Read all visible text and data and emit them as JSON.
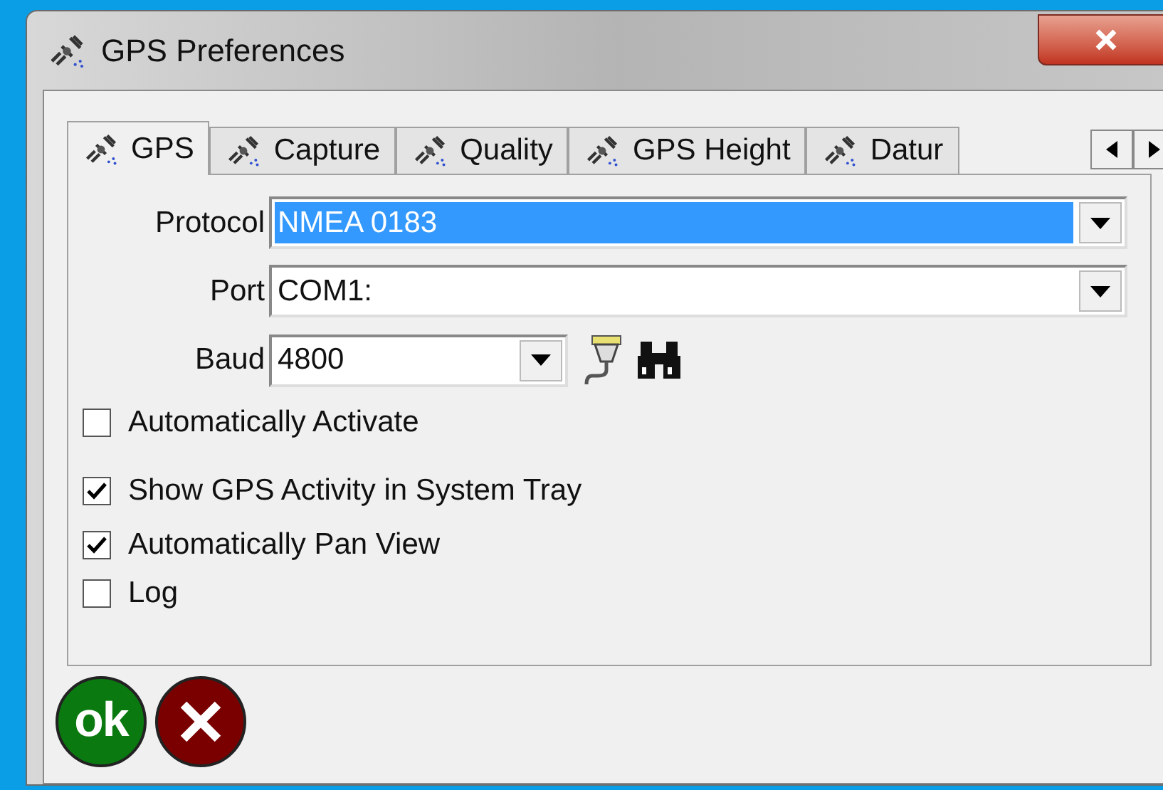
{
  "window": {
    "title": "GPS Preferences"
  },
  "tabs": [
    {
      "label": "GPS",
      "selected": true
    },
    {
      "label": "Capture",
      "selected": false
    },
    {
      "label": "Quality",
      "selected": false
    },
    {
      "label": "GPS Height",
      "selected": false
    },
    {
      "label": "Datur",
      "selected": false
    }
  ],
  "fields": [
    {
      "label": "Protocol",
      "value": "NMEA 0183",
      "highlighted": true,
      "kind": "wide"
    },
    {
      "label": "Port",
      "value": "COM1:",
      "highlighted": false,
      "kind": "wide"
    },
    {
      "label": "Baud",
      "value": "4800",
      "highlighted": false,
      "kind": "narrow"
    }
  ],
  "checkboxes": [
    {
      "label": "Automatically Activate",
      "checked": false
    },
    {
      "label": "Show GPS Activity in System Tray",
      "checked": true
    },
    {
      "label": "Automatically Pan View",
      "checked": true
    },
    {
      "label": "Log",
      "checked": false
    }
  ],
  "ok_button": {
    "label": "ok"
  }
}
